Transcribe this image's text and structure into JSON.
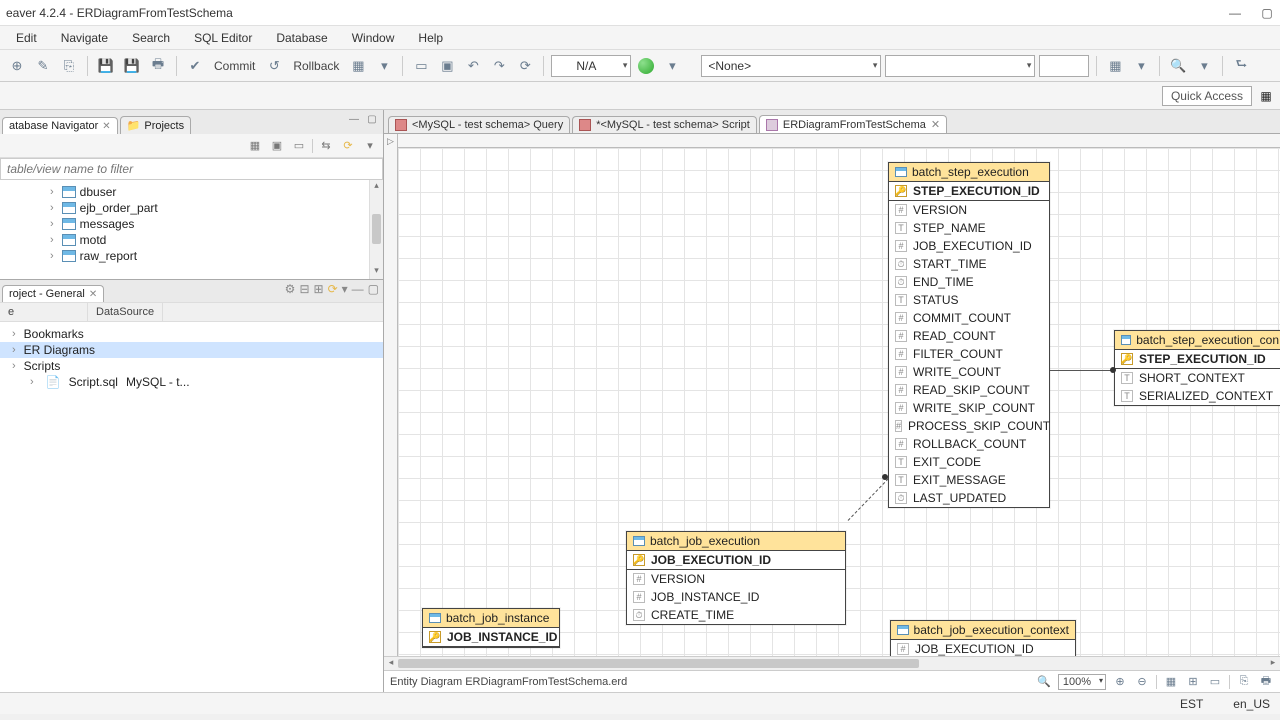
{
  "window": {
    "title": "eaver 4.2.4 - ERDiagramFromTestSchema"
  },
  "menu": [
    "Edit",
    "Navigate",
    "Search",
    "SQL Editor",
    "Database",
    "Window",
    "Help"
  ],
  "toolbar": {
    "commit": "Commit",
    "rollback": "Rollback",
    "na": "N/A",
    "none": "<None>"
  },
  "quick": {
    "label": "Quick Access"
  },
  "nav": {
    "tab1": "atabase Navigator",
    "tab2": "Projects",
    "filter_placeholder": "table/view name to filter",
    "items": [
      "dbuser",
      "ejb_order_part",
      "messages",
      "motd",
      "raw_report"
    ]
  },
  "project": {
    "title": "roject - General",
    "col1": "e",
    "col2": "DataSource",
    "items": {
      "bookmarks": "Bookmarks",
      "erd": "ER Diagrams",
      "scripts": "Scripts",
      "script_name": "Script.sql",
      "script_ds": "MySQL - t..."
    }
  },
  "editor_tabs": {
    "query": "<MySQL - test schema> Query",
    "script": "*<MySQL - test schema> Script",
    "erd": "ERDiagramFromTestSchema"
  },
  "entities": {
    "bse": {
      "name": "batch_step_execution",
      "pk": "STEP_EXECUTION_ID",
      "cols": [
        "VERSION",
        "STEP_NAME",
        "JOB_EXECUTION_ID",
        "START_TIME",
        "END_TIME",
        "STATUS",
        "COMMIT_COUNT",
        "READ_COUNT",
        "FILTER_COUNT",
        "WRITE_COUNT",
        "READ_SKIP_COUNT",
        "WRITE_SKIP_COUNT",
        "PROCESS_SKIP_COUNT",
        "ROLLBACK_COUNT",
        "EXIT_CODE",
        "EXIT_MESSAGE",
        "LAST_UPDATED"
      ]
    },
    "bsec": {
      "name": "batch_step_execution_con",
      "pk": "STEP_EXECUTION_ID",
      "cols": [
        "SHORT_CONTEXT",
        "SERIALIZED_CONTEXT"
      ]
    },
    "bje": {
      "name": "batch_job_execution",
      "pk": "JOB_EXECUTION_ID",
      "cols": [
        "VERSION",
        "JOB_INSTANCE_ID",
        "CREATE_TIME"
      ]
    },
    "bji": {
      "name": "batch_job_instance",
      "pk": "JOB_INSTANCE_ID"
    },
    "bjec": {
      "name": "batch_job_execution_context",
      "partial": "JOB_EXECUTION_ID"
    }
  },
  "status_strip": {
    "text": "Entity Diagram ERDiagramFromTestSchema.erd",
    "zoom": "100%"
  },
  "statusbar": {
    "kb": "EST",
    "locale": "en_US"
  }
}
